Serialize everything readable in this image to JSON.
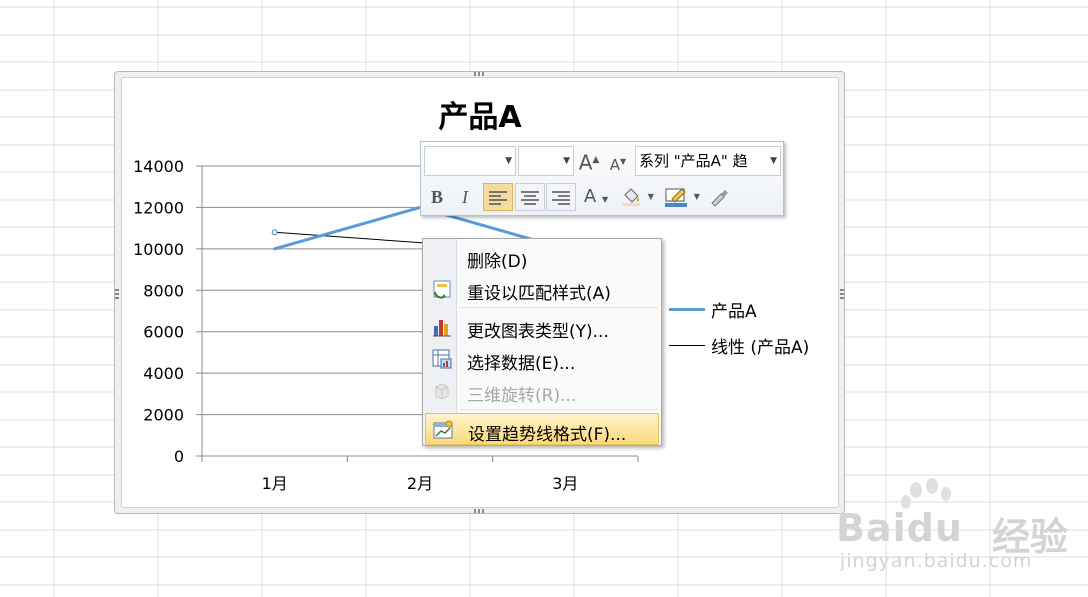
{
  "chart_data": {
    "type": "line",
    "title": "产品A",
    "categories": [
      "1月",
      "2月",
      "3月"
    ],
    "yticks": [
      "14000",
      "12000",
      "10000",
      "8000",
      "6000",
      "4000",
      "2000",
      "0"
    ],
    "ylim": [
      0,
      14000
    ],
    "series": [
      {
        "name": "产品A",
        "values": [
          10000,
          12000,
          10000
        ],
        "color": "#5b9bd5"
      },
      {
        "name": "线性 (产品A)",
        "values": [
          10800,
          10300,
          9800
        ],
        "color": "#000000"
      }
    ],
    "legend": [
      "产品A",
      "线性 (产品A)"
    ],
    "legend_position": "right",
    "grid": true
  },
  "toolbar": {
    "font_name": "",
    "font_size": "",
    "grow_font": "A",
    "shrink_font": "A",
    "element_selector": "系列 \"产品A\" 趋",
    "bold": "B",
    "italic": "I",
    "font_color": "A"
  },
  "menu": {
    "items": [
      {
        "label": "删除(D)",
        "enabled": true
      },
      {
        "label": "重设以匹配样式(A)",
        "enabled": true
      },
      {
        "label": "更改图表类型(Y)...",
        "enabled": true
      },
      {
        "label": "选择数据(E)...",
        "enabled": true
      },
      {
        "label": "三维旋转(R)...",
        "enabled": false
      },
      {
        "label": "设置趋势线格式(F)...",
        "enabled": true,
        "highlighted": true
      }
    ]
  },
  "watermark": {
    "brand": "Baidu",
    "suffix": "经验",
    "url": "jingyan.baidu.com"
  }
}
